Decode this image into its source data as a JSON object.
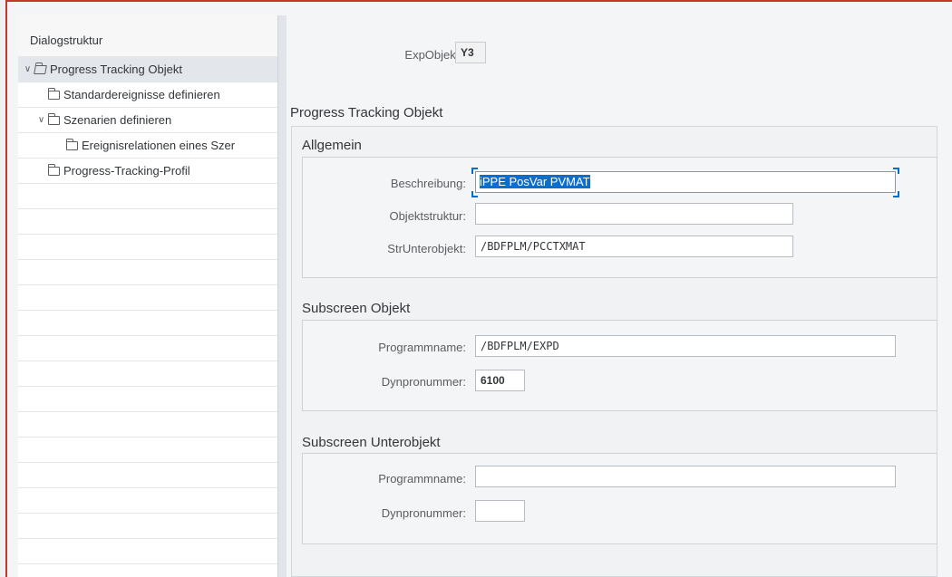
{
  "tree": {
    "header": "Dialogstruktur",
    "items": [
      {
        "label": "Progress Tracking Objekt"
      },
      {
        "label": "Standardereignisse definieren"
      },
      {
        "label": "Szenarien definieren"
      },
      {
        "label": "Ereignisrelationen eines Szer"
      },
      {
        "label": "Progress-Tracking-Profil"
      }
    ]
  },
  "header_fields": {
    "expobjekt_label": "ExpObjekt:",
    "expobjekt_value": "Y3"
  },
  "main": {
    "title": "Progress Tracking Objekt",
    "allgemein": {
      "title": "Allgemein",
      "beschreibung_label": "Beschreibung:",
      "beschreibung_value": "iPPE PosVar PVMAT",
      "objektstruktur_label": "Objektstruktur:",
      "objektstruktur_value": "",
      "strunterobjekt_label": "StrUnterobjekt:",
      "strunterobjekt_value": "/BDFPLM/PCCTXMAT"
    },
    "subscreen_objekt": {
      "title": "Subscreen Objekt",
      "programmname_label": "Programmname:",
      "programmname_value": "/BDFPLM/EXPD",
      "dynpronummer_label": "Dynpronummer:",
      "dynpronummer_value": "6100"
    },
    "subscreen_unterobjekt": {
      "title": "Subscreen Unterobjekt",
      "programmname_label": "Programmname:",
      "programmname_value": "",
      "dynpronummer_label": "Dynpronummer:",
      "dynpronummer_value": ""
    }
  },
  "colors": {
    "frame_border": "#c0392b",
    "selection": "#0a6ed1"
  }
}
